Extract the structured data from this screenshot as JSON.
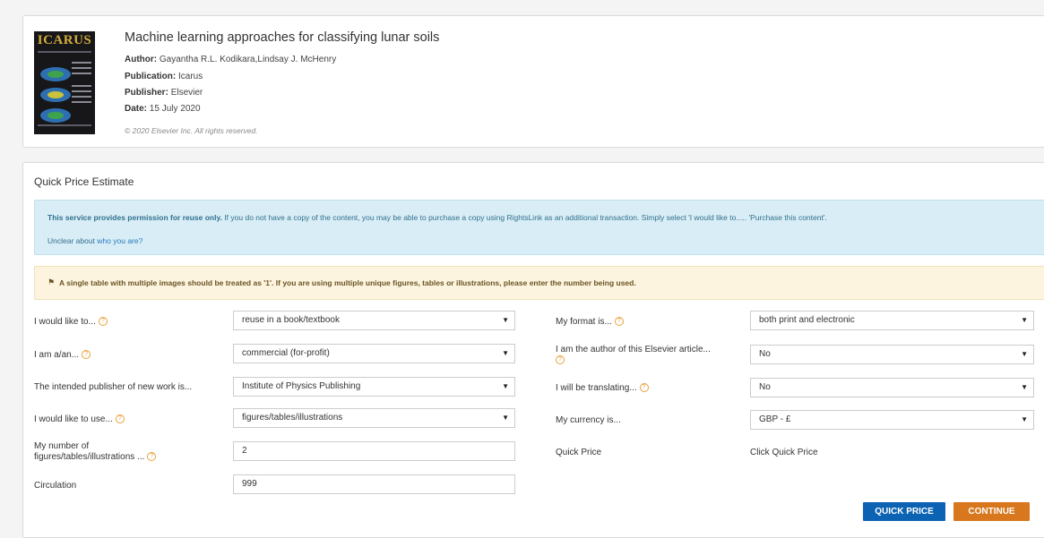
{
  "article": {
    "cover_logo": "ICARUS",
    "title": "Machine learning approaches for classifying lunar soils",
    "author_label": "Author:",
    "author": "Gayantha R.L. Kodikara,Lindsay J. McHenry",
    "publication_label": "Publication:",
    "publication": "Icarus",
    "publisher_label": "Publisher:",
    "publisher": "Elsevier",
    "date_label": "Date:",
    "date": "15 July 2020",
    "copyright": "© 2020 Elsevier Inc. All rights reserved."
  },
  "quote": {
    "title": "Quick Price Estimate",
    "info_bold": "This service provides permission for reuse only.",
    "info_text": " If you do not have a copy of the content, you may be able to purchase a copy using RightsLink as an additional transaction. Simply select 'I would like to..... 'Purchase this content'.",
    "unclear_text": "Unclear about ",
    "unclear_link": "who you are?",
    "warning": "A single table with multiple images should be treated as '1'. If you are using multiple unique figures, tables or illustrations, please enter the number being used."
  },
  "form_left": {
    "would_like_label": "I would like to...",
    "would_like_value": "reuse in a book/textbook",
    "i_am_label": "I am a/an...",
    "i_am_value": "commercial (for-profit)",
    "publisher_label": "The intended publisher of new work is...",
    "publisher_value": "Institute of Physics Publishing",
    "use_label": "I would like to use...",
    "use_value": "figures/tables/illustrations",
    "number_label_1": "My number of",
    "number_label_2": "figures/tables/illustrations ...",
    "number_value": "2",
    "circulation_label": "Circulation",
    "circulation_value": "999"
  },
  "form_right": {
    "format_label": "My format is...",
    "format_value": "both print and electronic",
    "author_label": "I am the author of this Elsevier article...",
    "author_value": "No",
    "translating_label": "I will be translating...",
    "translating_value": "No",
    "currency_label": "My currency is...",
    "currency_value": "GBP - £",
    "quick_price_label": "Quick Price",
    "quick_price_value": "Click Quick Price"
  },
  "buttons": {
    "quick_price": "QUICK PRICE",
    "continue": "CONTINUE"
  },
  "icons": {
    "help": "question-circle-icon",
    "dropdown": "caret-down-icon",
    "warning": "flag-icon"
  },
  "colors": {
    "primary_button": "#0d63b3",
    "continue_button": "#d9771e",
    "info_bg": "#d8edf5",
    "warning_bg": "#fcf4de",
    "help_icon": "#e9a23b"
  }
}
